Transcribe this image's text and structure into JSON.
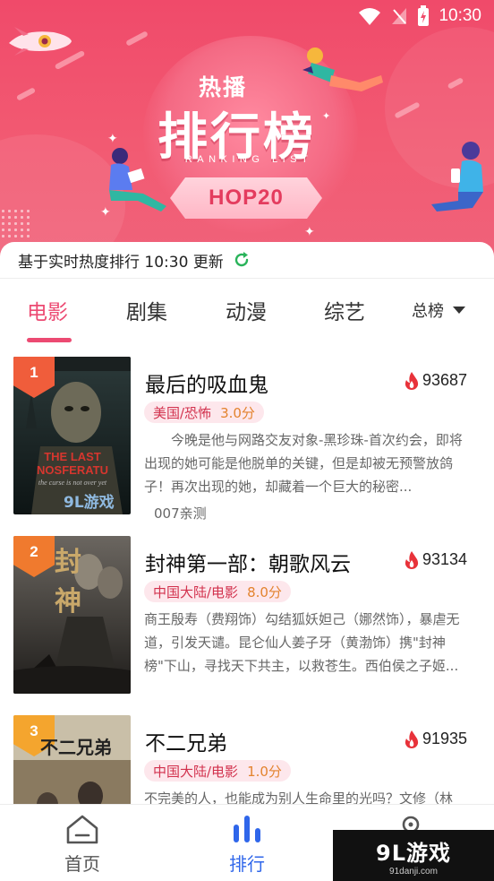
{
  "status_bar": {
    "time": "10:30"
  },
  "banner": {
    "title_small": "热播",
    "title_big": "排行榜",
    "subtitle": "RANKING LIST",
    "ribbon": "HOP20"
  },
  "update_bar": {
    "text": "基于实时热度排行 10:30 更新"
  },
  "tabs": [
    {
      "label": "电影",
      "active": true
    },
    {
      "label": "剧集",
      "active": false
    },
    {
      "label": "动漫",
      "active": false
    },
    {
      "label": "综艺",
      "active": false
    }
  ],
  "dropdown": {
    "selected": "总榜"
  },
  "items": [
    {
      "rank": "1",
      "title": "最后的吸血鬼",
      "heat": "93687",
      "genre": "美国/恐怖",
      "score": "3.0分",
      "description": "　　今晚是他与网路交友对象-黑珍珠-首次约会，即将出现的她可能是他脱单的关键，但是却被无预警放鸽子！再次出现的她，却藏着一个巨大的秘密...",
      "source": "007亲测",
      "poster_text": "THE LAST NOSFERATU",
      "poster_tagline": "the curse is not over yet"
    },
    {
      "rank": "2",
      "title": "封神第一部：朝歌风云",
      "heat": "93134",
      "genre": "中国大陆/电影",
      "score": "8.0分",
      "description": "商王殷寿（费翔饰）勾结狐妖妲己（娜然饰），暴虐无道，引发天谴。昆仑仙人姜子牙（黄渤饰）携\"封神榜\"下山，寻找天下共主，以救苍生。西伯侯之子姬...",
      "poster_text": "封神"
    },
    {
      "rank": "3",
      "title": "不二兄弟",
      "heat": "91935",
      "genre": "中国大陆/电影",
      "score": "1.0分",
      "description": "不完美的人，也能成为别人生命里的光吗？文修（林",
      "poster_text": "不二兄弟"
    }
  ],
  "bottom_nav": [
    {
      "label": "首页",
      "icon": "home-icon",
      "active": false
    },
    {
      "label": "排行",
      "icon": "ranking-icon",
      "active": true
    }
  ],
  "watermark": {
    "main": "9L游戏",
    "sub": "91danji.com",
    "poster_mark": "9L游戏"
  },
  "colors": {
    "accent": "#ec4a72",
    "banner": "#f04a6a",
    "badge": "#f05d3b",
    "nav_active": "#2f66ea",
    "score": "#e3832e"
  }
}
